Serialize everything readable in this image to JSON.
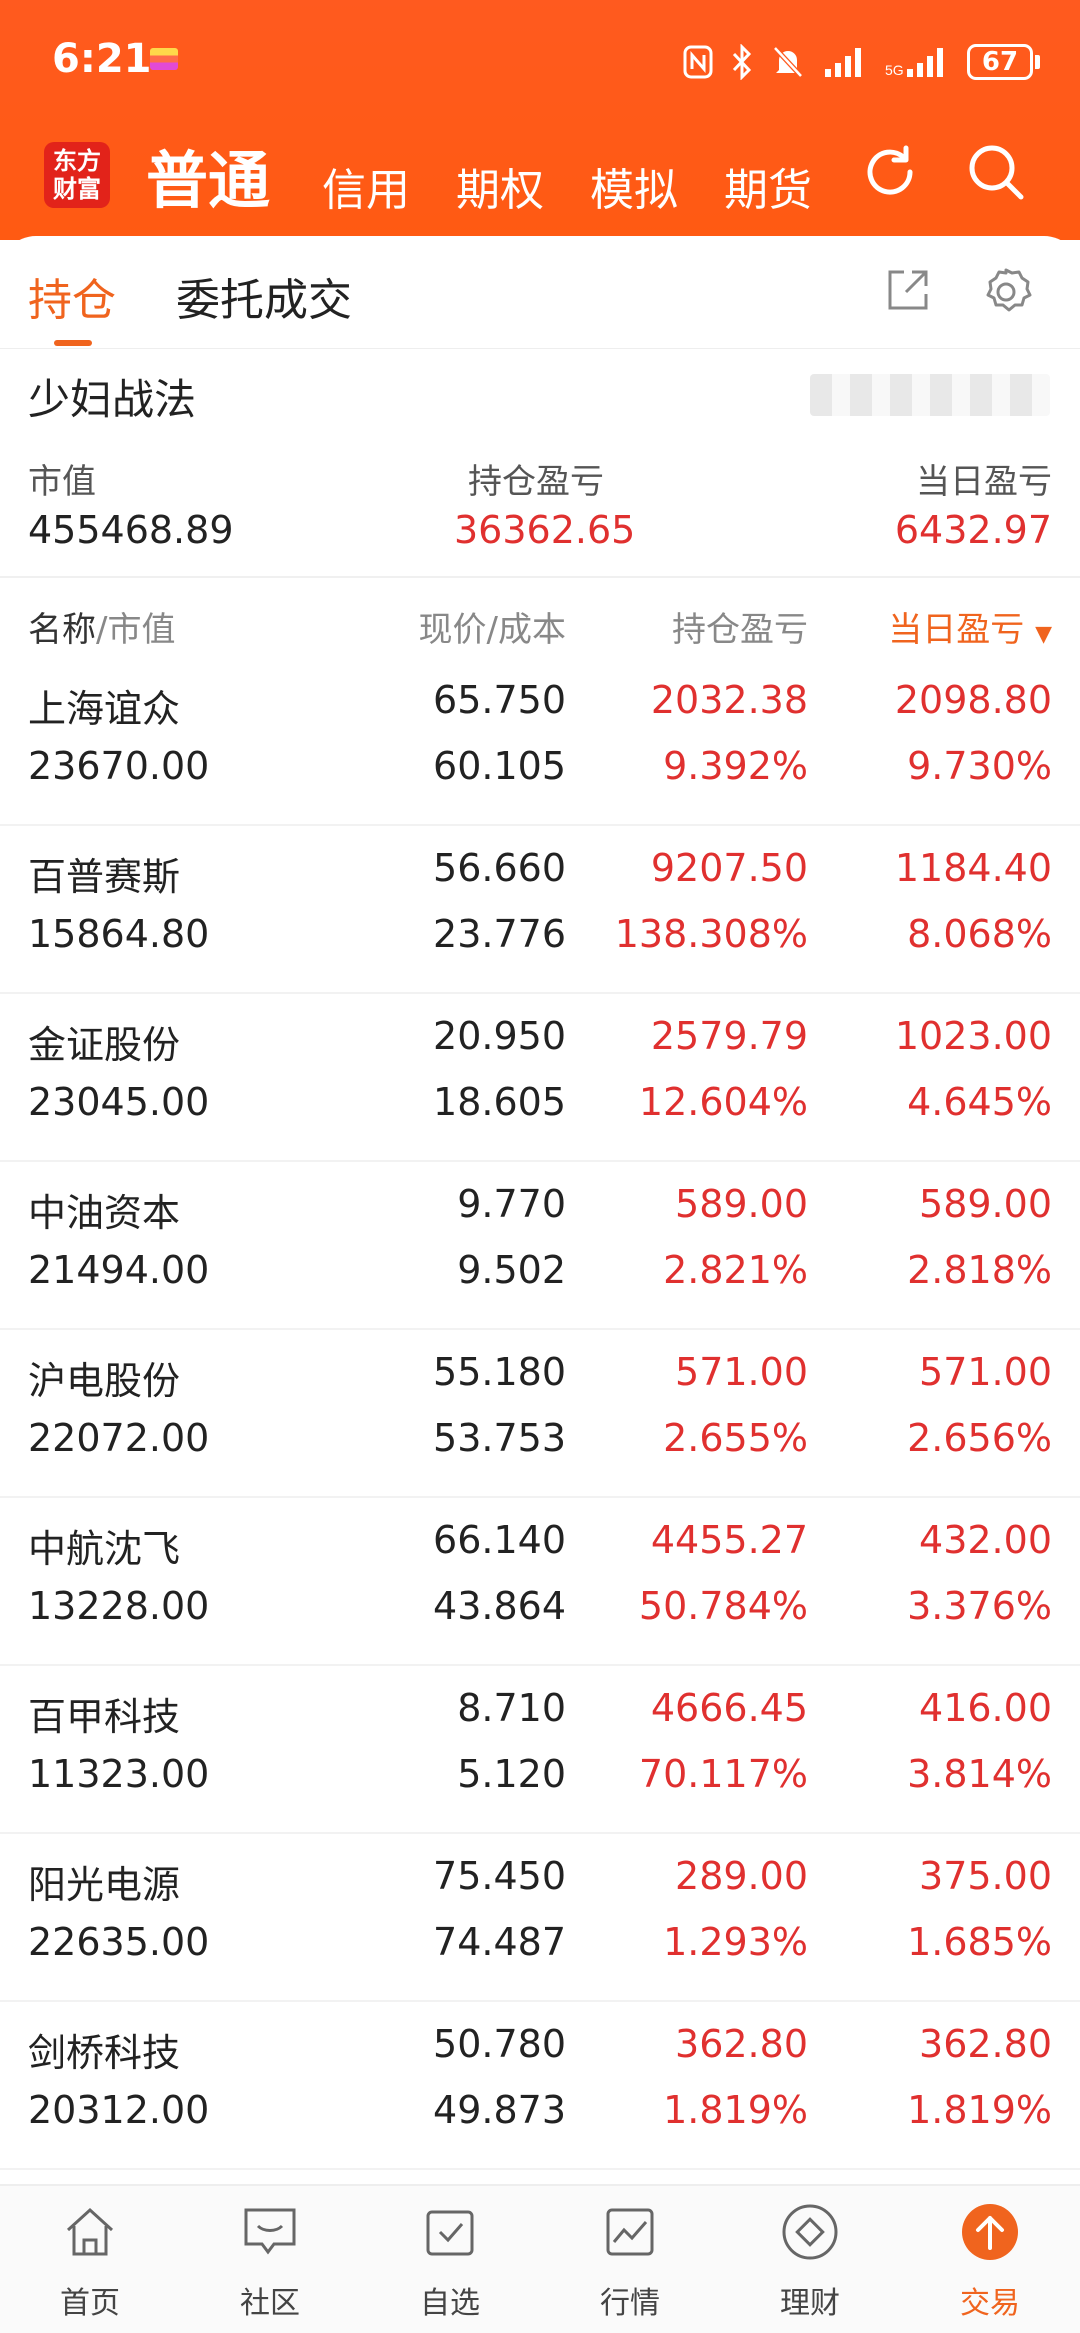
{
  "status": {
    "time": "6:21",
    "battery": "67"
  },
  "topnav": {
    "logo": [
      "东方",
      "财富"
    ],
    "main": "普通",
    "items": [
      "信用",
      "期权",
      "模拟",
      "期货"
    ]
  },
  "tabs": {
    "active": "持仓",
    "other": "委托成交"
  },
  "account": {
    "title": "少妇战法"
  },
  "summary": {
    "market_value_label": "市值",
    "market_value": "455468.89",
    "position_pl_label": "持仓盈亏",
    "position_pl": "36362.65",
    "day_pl_label": "当日盈亏",
    "day_pl": "6432.97"
  },
  "columns": {
    "name": "名称",
    "mv": "/市值",
    "price_cost": "现价/成本",
    "position_pl": "持仓盈亏",
    "day_pl": "当日盈亏"
  },
  "holdings": [
    {
      "name": "上海谊众",
      "mv": "23670.00",
      "price": "65.750",
      "cost": "60.105",
      "pl": "2032.38",
      "plpct": "9.392%",
      "day": "2098.80",
      "daypct": "9.730%"
    },
    {
      "name": "百普赛斯",
      "mv": "15864.80",
      "price": "56.660",
      "cost": "23.776",
      "pl": "9207.50",
      "plpct": "138.308%",
      "day": "1184.40",
      "daypct": "8.068%"
    },
    {
      "name": "金证股份",
      "mv": "23045.00",
      "price": "20.950",
      "cost": "18.605",
      "pl": "2579.79",
      "plpct": "12.604%",
      "day": "1023.00",
      "daypct": "4.645%"
    },
    {
      "name": "中油资本",
      "mv": "21494.00",
      "price": "9.770",
      "cost": "9.502",
      "pl": "589.00",
      "plpct": "2.821%",
      "day": "589.00",
      "daypct": "2.818%"
    },
    {
      "name": "沪电股份",
      "mv": "22072.00",
      "price": "55.180",
      "cost": "53.753",
      "pl": "571.00",
      "plpct": "2.655%",
      "day": "571.00",
      "daypct": "2.656%"
    },
    {
      "name": "中航沈飞",
      "mv": "13228.00",
      "price": "66.140",
      "cost": "43.864",
      "pl": "4455.27",
      "plpct": "50.784%",
      "day": "432.00",
      "daypct": "3.376%"
    },
    {
      "name": "百甲科技",
      "mv": "11323.00",
      "price": "8.710",
      "cost": "5.120",
      "pl": "4666.45",
      "plpct": "70.117%",
      "day": "416.00",
      "daypct": "3.814%"
    },
    {
      "name": "阳光电源",
      "mv": "22635.00",
      "price": "75.450",
      "cost": "74.487",
      "pl": "289.00",
      "plpct": "1.293%",
      "day": "375.00",
      "daypct": "1.685%"
    },
    {
      "name": "剑桥科技",
      "mv": "20312.00",
      "price": "50.780",
      "cost": "49.873",
      "pl": "362.80",
      "plpct": "1.819%",
      "day": "362.80",
      "daypct": "1.819%"
    }
  ],
  "bottom_nav": [
    "首页",
    "社区",
    "自选",
    "行情",
    "理财",
    "交易"
  ],
  "colors": {
    "accent": "#f0641e",
    "header": "#ff5a1f",
    "profit": "#e0302f"
  }
}
